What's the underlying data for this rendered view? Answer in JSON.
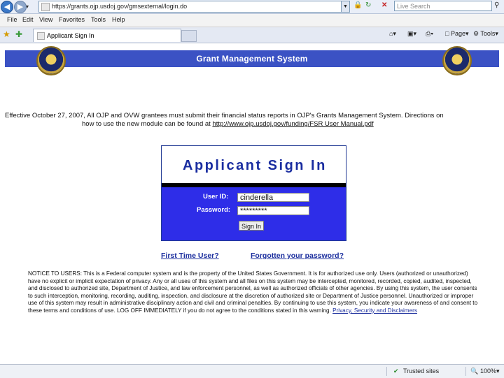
{
  "browser": {
    "url": "https://grants.ojp.usdoj.gov/gmsexternal/login.do",
    "search_placeholder": "Live Search",
    "menu": [
      "File",
      "Edit",
      "View",
      "Favorites",
      "Tools",
      "Help"
    ],
    "tab_title": "Applicant Sign In",
    "page_label": "Page",
    "tools_label": "Tools",
    "status_zone": "Trusted sites",
    "zoom": "100%"
  },
  "header": {
    "title": "Grant Management System"
  },
  "notice": {
    "line1": "Effective October 27, 2007, All OJP and OVW grantees must submit their financial status reports in OJP's Grants Management System. Directions on",
    "line2_prefix": "how to use the new module can be found at ",
    "link": "http://www.ojp.usdoj.gov/funding/FSR User Manual.pdf"
  },
  "signin": {
    "title": "Applicant Sign In",
    "userid_label": "User ID:",
    "userid_value": "cinderella",
    "password_label": "Password:",
    "password_value": "*********",
    "button": "Sign In"
  },
  "links": {
    "first_time": "First Time User?",
    "forgot": "Forgotten your password?"
  },
  "legal": {
    "text": "NOTICE TO USERS: This is a Federal computer system and is the property of the United States Government. It is for authorized use only. Users (authorized or unauthorized) have no explicit or implicit expectation of privacy. Any or all uses of this system and all files on this system may be intercepted, monitored, recorded, copied, audited, inspected, and disclosed to authorized site, Department of Justice, and law enforcement personnel, as well as authorized officials of other agencies. By using this system, the user consents to such interception, monitoring, recording, auditing, inspection, and disclosure at the discretion of authorized site or Department of Justice personnel. Unauthorized or improper use of this system may result in administrative disciplinary action and civil and criminal penalties. By continuing to use this system, you indicate your awareness of and consent to these terms and conditions of use. LOG OFF IMMEDIATELY if you do not agree to the conditions stated in this warning. ",
    "link": "Privacy, Security and Disclaimers"
  },
  "icons": {
    "back": "back-arrow-icon",
    "forward": "forward-arrow-icon",
    "lock": "lock-icon",
    "refresh": "refresh-icon",
    "stop": "stop-icon"
  }
}
